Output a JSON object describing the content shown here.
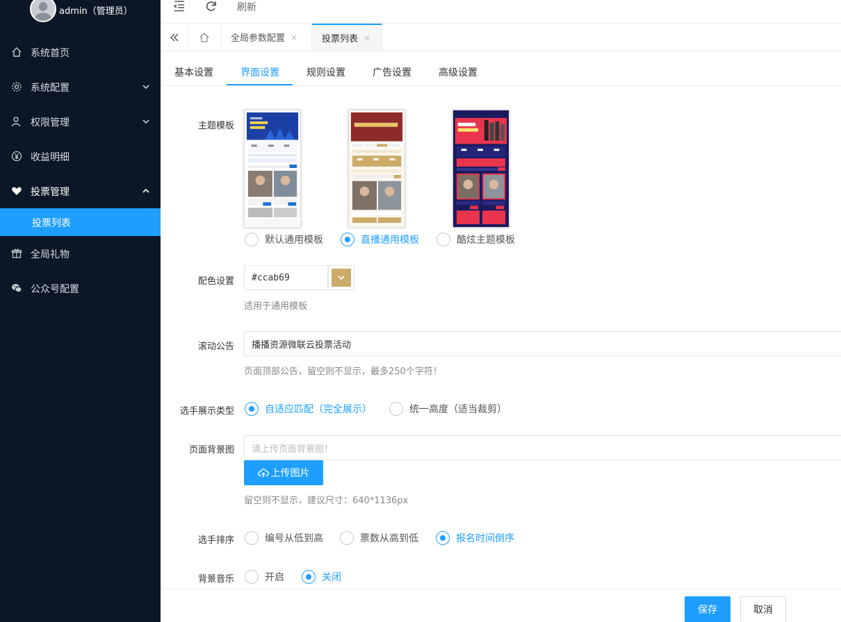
{
  "user": {
    "name": "admin（管理员）"
  },
  "sidebar": {
    "items": [
      {
        "label": "系统首页",
        "icon": "home-icon"
      },
      {
        "label": "系统配置",
        "icon": "gear-icon"
      },
      {
        "label": "权限管理",
        "icon": "user-icon"
      },
      {
        "label": "收益明细",
        "icon": "yen-icon"
      },
      {
        "label": "投票管理",
        "icon": "heart-icon"
      },
      {
        "label": "投票列表"
      },
      {
        "label": "全局礼物",
        "icon": "gift-icon"
      },
      {
        "label": "公众号配置",
        "icon": "wechat-icon"
      }
    ]
  },
  "topbar": {
    "refresh_label": "刷新"
  },
  "tabs": [
    {
      "label": "全局参数配置",
      "close": "×"
    },
    {
      "label": "投票列表",
      "close": "×"
    }
  ],
  "subtabs": [
    "基本设置",
    "界面设置",
    "规则设置",
    "广告设置",
    "高级设置"
  ],
  "form": {
    "theme": {
      "label": "主题模板",
      "options": [
        "默认通用模板",
        "直播通用模板",
        "酷炫主题模板"
      ],
      "selected": "直播通用模板"
    },
    "color": {
      "label": "配色设置",
      "value": "#ccab69",
      "help": "适用于通用模板",
      "swatch": "#ccab69"
    },
    "notice": {
      "label": "滚动公告",
      "value": "播播资源微联云投票活动",
      "help": "页面顶部公告，留空则不显示，最多250个字符！"
    },
    "display": {
      "label": "选手展示类型",
      "options": [
        "自适应匹配（完全展示）",
        "统一高度（适当裁剪）"
      ],
      "selected": "自适应匹配（完全展示）"
    },
    "background": {
      "label": "页面背景图",
      "placeholder": "请上传页面背景图！",
      "upload_label": "上传图片",
      "help": "留空则不显示，建议尺寸：640*1136px"
    },
    "sort": {
      "label": "选手排序",
      "options": [
        "编号从低到高",
        "票数从高到低",
        "报名时间倒序"
      ],
      "selected": "报名时间倒序"
    },
    "music": {
      "label": "背景音乐",
      "options": [
        "开启",
        "关闭"
      ],
      "selected": "关闭"
    }
  },
  "footer": {
    "save_label": "保存",
    "cancel_label": "取消"
  },
  "colors": {
    "accent": "#1e9fff",
    "sidebar_bg": "#0b1726"
  }
}
